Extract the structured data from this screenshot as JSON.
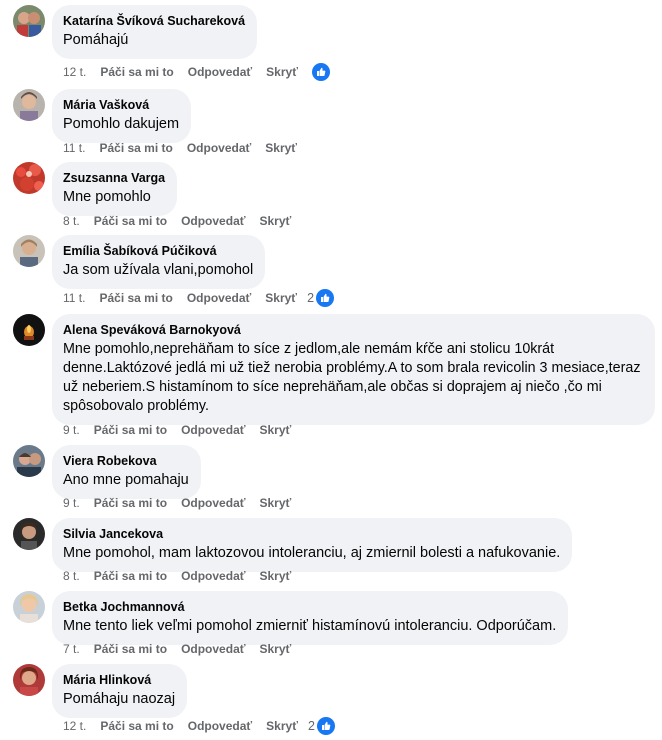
{
  "labels": {
    "like": "Páči sa mi to",
    "reply": "Odpovedať",
    "hide": "Skryť"
  },
  "comments": [
    {
      "author": "Katarína Švíková Suchareková",
      "text": "Pomáhajú",
      "time": "12 t.",
      "likes": ""
    },
    {
      "author": "Mária Vašková",
      "text": "Pomohlo dakujem",
      "time": "11 t.",
      "likes": ""
    },
    {
      "author": "Zsuzsanna Varga",
      "text": "Mne pomohlo",
      "time": "8 t.",
      "likes": ""
    },
    {
      "author": "Emília Šabíková Púčiková",
      "text": "Ja som užívala vlani,pomohol",
      "time": "11 t.",
      "likes": "2"
    },
    {
      "author": "Alena Speváková Barnokyová",
      "text": "Mne pomohlo,neprehäňam to síce z jedlom,ale nemám kŕče ani stolicu 10krát denne.Laktózové jedlá mi už tiež nerobia problémy.A to som brala revicolin 3 mesiace,teraz už neberiem.S histamínom to síce neprehäňam,ale občas si doprajem aj niečo ,čo mi spôsobovalo problémy.",
      "time": "9 t.",
      "likes": ""
    },
    {
      "author": "Viera Robekova",
      "text": "Ano mne pomahaju",
      "time": "9 t.",
      "likes": ""
    },
    {
      "author": "Silvia Jancekova",
      "text": "Mne pomohol, mam laktozovou intoleranciu, aj zmiernil bolesti a nafukovanie.",
      "time": "8 t.",
      "likes": ""
    },
    {
      "author": "Betka Jochmannová",
      "text": "Mne tento liek veľmi pomohol zmierniť histamínovú intoleranciu. Odporúčam.",
      "time": "7 t.",
      "likes": ""
    },
    {
      "author": "Mária Hlinková",
      "text": "Pomáhaju naozaj",
      "time": "12 t.",
      "likes": "2"
    }
  ],
  "colors": {
    "bubble": "#f0f2f5",
    "meta": "#65676b",
    "like_blue": "#1877f2"
  },
  "icons": [
    "thumbs-up-icon"
  ]
}
